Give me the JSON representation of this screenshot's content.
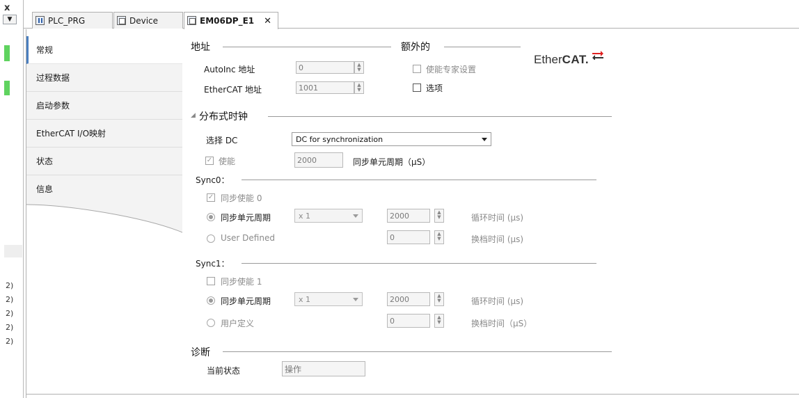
{
  "gutter": {
    "close_glyph": "x",
    "arrow_glyph": "▼",
    "rows": [
      "2)",
      "2)",
      "2)",
      "2)",
      "2)"
    ]
  },
  "tabs": [
    {
      "label": "PLC_PRG",
      "icon": "program-icon"
    },
    {
      "label": "Device",
      "icon": "device-icon"
    },
    {
      "label": "EM06DP_E1",
      "icon": "device-icon",
      "close": "✕"
    }
  ],
  "nav": [
    "常规",
    "过程数据",
    "启动参数",
    "EtherCAT I/O映射",
    "状态",
    "信息"
  ],
  "address": {
    "title": "地址",
    "autoinc_label": "AutoInc 地址",
    "autoinc_value": "0",
    "ethercat_label": "EtherCAT 地址",
    "ethercat_value": "1001"
  },
  "extra": {
    "title": "额外的",
    "expert_label": "使能专家设置",
    "options_label": "选项"
  },
  "logo": {
    "text_a": "Ether",
    "text_b": "CAT."
  },
  "dc": {
    "title": "分布式时钟",
    "select_label": "选择 DC",
    "select_value": "DC for synchronization",
    "enable_label": "使能",
    "cycle_value": "2000",
    "cycle_label": "同步单元周期（μS）"
  },
  "sync0": {
    "title": "Sync0：",
    "enable_label": "同步使能 0",
    "unit_cycle_label": "同步单元周期",
    "multiplier": "x 1",
    "cycle_value": "2000",
    "cycle_time_label": "循环时间 (µs)",
    "user_defined_label": "User Defined",
    "shift_value": "0",
    "shift_time_label": "换档时间 (µs)"
  },
  "sync1": {
    "title": "Sync1：",
    "enable_label": "同步使能 1",
    "unit_cycle_label": "同步单元周期",
    "multiplier": "x 1",
    "cycle_value": "2000",
    "cycle_time_label": "循环时间 (µs)",
    "user_defined_label": "用户定义",
    "shift_value": "0",
    "shift_time_label": "换档时间（μS）"
  },
  "diag": {
    "title": "诊断",
    "state_label": "当前状态",
    "state_value": "操作"
  },
  "colors": {
    "accent": "#4a7fbf",
    "gutter_green": "#5fd35f",
    "logo_red": "#e02020"
  }
}
